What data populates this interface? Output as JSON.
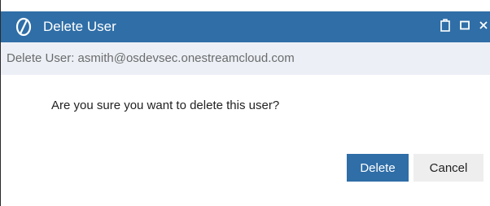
{
  "dialog": {
    "title": "Delete User",
    "subheader": "Delete User: asmith@osdevsec.onestreamcloud.com",
    "message": "Are you sure you want to delete this user?",
    "icons": {
      "app_logo": "onestream-logo-icon",
      "restore": "restore-icon",
      "maximize": "maximize-icon",
      "close": "close-icon"
    },
    "buttons": {
      "delete_label": "Delete",
      "cancel_label": "Cancel"
    }
  },
  "colors": {
    "titlebar": "#2f6ea7",
    "subheader_bg": "#ecf0f6",
    "primary_button": "#2f6ea7",
    "secondary_button": "#eeeeee"
  }
}
